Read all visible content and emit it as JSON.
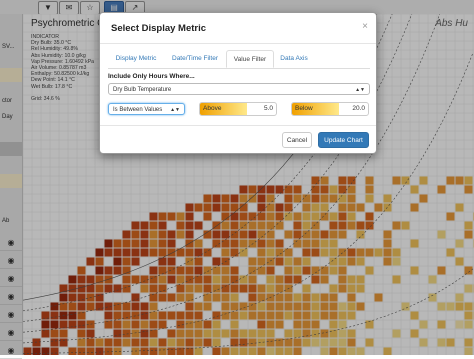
{
  "toolbar": {
    "buttons": [
      "▼",
      "✉",
      "☆",
      "▤",
      "↗"
    ]
  },
  "sidebar": {
    "rows": [
      "SV...",
      "",
      "",
      "",
      "ctor",
      "Day",
      "",
      "",
      "Ab",
      "",
      "",
      ""
    ]
  },
  "chart": {
    "title": "Psychrometric Chart",
    "right_title": "Abs Hu",
    "info_lines": [
      "INDICATOR",
      "Dry Bulb: 35.0 °C",
      "Rel Humidity: 49.8%",
      "Abs Humidity: 10.0 g/kg",
      "Vap Pressure: 1.60492 kPa",
      "Air Volume: 0.85787 m3",
      "Enthalpy: 50.82500 kJ/kg",
      "Dew Point: 14.1 °C",
      "Wet Bulb: 17.8 °C",
      "",
      "Grid: 34.6 %"
    ]
  },
  "modal": {
    "title": "Select Display Metric",
    "close": "×",
    "tabs": [
      "Display Metric",
      "Date/Time Filter",
      "Value Filter",
      "Data Axis"
    ],
    "active_tab": "Value Filter",
    "section_label": "Include Only Hours Where...",
    "metric_select": "Dry Bulb Temperature",
    "condition_select": "Is Between Values",
    "above_label": "Above",
    "above_value": "5.0",
    "below_label": "Below",
    "below_value": "20.0",
    "cancel_label": "Cancel",
    "update_label": "Update Chart"
  },
  "colors": {
    "primary": "#3379b7",
    "range_start": "#f0a000",
    "range_end": "#ffe98a"
  }
}
